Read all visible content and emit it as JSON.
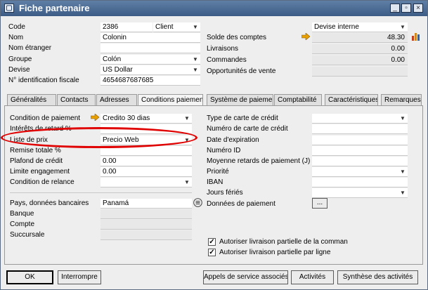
{
  "window": {
    "title": "Fiche partenaire",
    "icon": "window-app-icon"
  },
  "header": {
    "code_label": "Code",
    "code_value": "2386",
    "type_value": "Client",
    "nom_label": "Nom",
    "nom_value": "Colonin",
    "nom_etranger_label": "Nom étranger",
    "nom_etranger_value": "",
    "groupe_label": "Groupe",
    "groupe_value": "Colón",
    "devise_label": "Devise",
    "devise_value": "US Dollar",
    "nif_label": "N° identification fiscale",
    "nif_value": "4654687687685",
    "devise_interne_value": "Devise interne",
    "solde_label": "Solde des comptes",
    "solde_value": "48.30",
    "livraisons_label": "Livraisons",
    "livraisons_value": "0.00",
    "commandes_label": "Commandes",
    "commandes_value": "0.00",
    "opportunites_label": "Opportunités de vente",
    "opportunites_value": ""
  },
  "tabs": [
    {
      "label": "Généralités"
    },
    {
      "label": "Contacts"
    },
    {
      "label": "Adresses"
    },
    {
      "label": "Conditions paiement"
    },
    {
      "label": "Système de paiement"
    },
    {
      "label": "Comptabilité"
    },
    {
      "label": "Caractéristiques"
    },
    {
      "label": "Remarques"
    }
  ],
  "active_tab": "Conditions paiement",
  "left_panel": {
    "condition_label": "Condition de paiement",
    "condition_value": "Credito 30 dias",
    "interets_label": "Intérêts de retard %",
    "interets_value": "",
    "liste_prix_label": "Liste de prix",
    "liste_prix_value": "Precio Web",
    "remise_label": "Remise totale %",
    "remise_value": "",
    "plafond_label": "Plafond de crédit",
    "plafond_value": "0.00",
    "limite_label": "Limite engagement",
    "limite_value": "0.00",
    "relance_label": "Condition de relance",
    "relance_value": "",
    "pays_label": "Pays, données bancaires",
    "pays_value": "Panamá",
    "banque_label": "Banque",
    "banque_value": "",
    "compte_label": "Compte",
    "compte_value": "",
    "succursale_label": "Succursale",
    "succursale_value": ""
  },
  "right_panel": {
    "type_carte_label": "Type de carte de crédit",
    "num_carte_label": "Numéro de carte de crédit",
    "date_exp_label": "Date d'expiration",
    "num_id_label": "Numéro ID",
    "moyenne_label": "Moyenne retards de paiement (J)",
    "priorite_label": "Priorité",
    "iban_label": "IBAN",
    "jours_feries_label": "Jours fériés",
    "donnees_paiement_label": "Données de paiement",
    "donnees_paiement_button": "...",
    "chk1_label": "Autoriser livraison partielle de la comman",
    "chk2_label": "Autoriser livraison partielle par ligne",
    "chk1_checked": true,
    "chk2_checked": true
  },
  "footer": {
    "ok": "OK",
    "interrompre": "Interrompre",
    "appels": "Appels de service associés",
    "activites": "Activités",
    "synthese": "Synthèse des activités"
  },
  "colors": {
    "highlight_ellipse": "#e00000",
    "link_arrow": "#e8a000",
    "titlebar": "#4a6a94"
  }
}
